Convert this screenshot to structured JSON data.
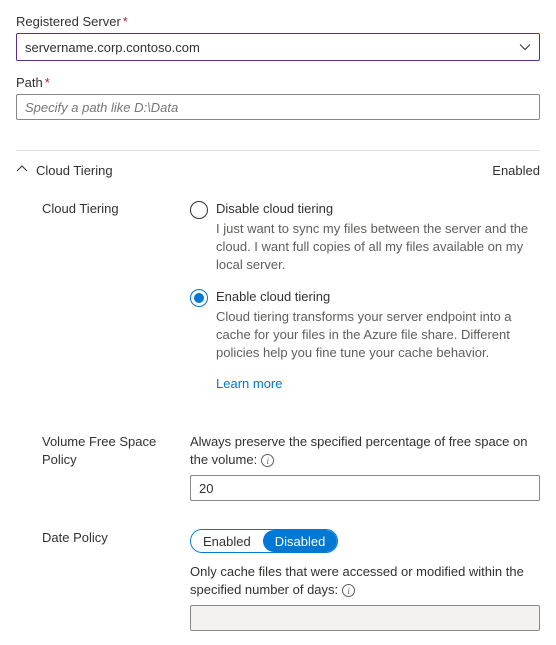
{
  "registeredServer": {
    "label": "Registered Server",
    "required": "*",
    "value": "servername.corp.contoso.com"
  },
  "path": {
    "label": "Path",
    "required": "*",
    "placeholder": "Specify a path like D:\\Data",
    "value": ""
  },
  "cloudTieringSection": {
    "title": "Cloud Tiering",
    "status": "Enabled"
  },
  "cloudTieringField": {
    "label": "Cloud Tiering",
    "disableOption": {
      "title": "Disable cloud tiering",
      "desc": "I just want to sync my files between the server and the cloud. I want full copies of all my files available on my local server."
    },
    "enableOption": {
      "title": "Enable cloud tiering",
      "desc": "Cloud tiering transforms your server endpoint into a cache for your files in the Azure file share. Different policies help you fine tune your cache behavior."
    },
    "learnMore": "Learn more"
  },
  "volumePolicy": {
    "label": "Volume Free Space Policy",
    "help": "Always preserve the specified percentage of free space on the volume:",
    "value": "20"
  },
  "datePolicy": {
    "label": "Date Policy",
    "toggle": {
      "enabled": "Enabled",
      "disabled": "Disabled"
    },
    "help": "Only cache files that were accessed or modified within the specified number of days:",
    "value": ""
  }
}
